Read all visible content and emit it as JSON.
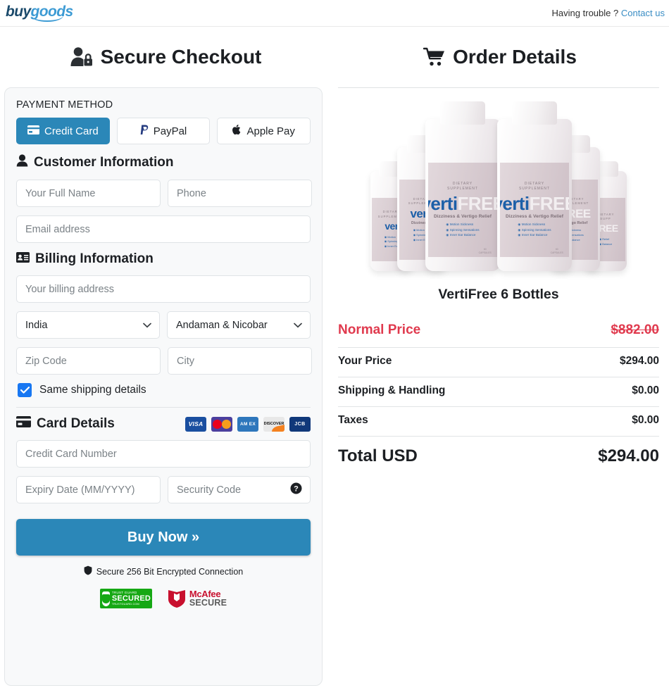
{
  "header": {
    "logo_buy": "buy",
    "logo_goods": "goods",
    "help_text": "Having trouble ?",
    "contact_link": "Contact us"
  },
  "left": {
    "title": "Secure Checkout",
    "payment_method_label": "PAYMENT METHOD",
    "payment_methods": [
      {
        "label": "Credit Card",
        "icon": "credit-card-icon",
        "active": true
      },
      {
        "label": "PayPal",
        "icon": "paypal-icon",
        "active": false
      },
      {
        "label": "Apple Pay",
        "icon": "apple-icon",
        "active": false
      }
    ],
    "customer_section": {
      "title": "Customer Information",
      "full_name_placeholder": "Your Full Name",
      "phone_placeholder": "Phone",
      "email_placeholder": "Email address"
    },
    "billing_section": {
      "title": "Billing Information",
      "address_placeholder": "Your billing address",
      "country_value": "India",
      "state_value": "Andaman & Nicobar",
      "zip_placeholder": "Zip Code",
      "city_placeholder": "City",
      "same_shipping_label": "Same shipping details",
      "same_shipping_checked": true
    },
    "card_section": {
      "title": "Card Details",
      "brands": [
        "VISA",
        "Mastercard",
        "AM EX",
        "DISCOVER",
        "JCB"
      ],
      "card_number_placeholder": "Credit Card Number",
      "expiry_placeholder": "Expiry Date (MM/YYYY)",
      "security_code_placeholder": "Security Code"
    },
    "buy_button": "Buy Now »",
    "secure_note": "Secure 256 Bit Encrypted Connection",
    "badges": {
      "trust_guard_top": "TRUST GUARD",
      "trust_guard_mid": "SECURED",
      "trust_guard_bottom": "TRUSTGUARD.COM",
      "mcafee_top": "McAfee",
      "mcafee_bottom": "SECURE"
    }
  },
  "right": {
    "title": "Order Details",
    "product_name": "VertiFree 6 Bottles",
    "product_label": {
      "supplement_line1": "DIETARY",
      "supplement_line2": "SUPPLEMENT",
      "brand_first": "verti",
      "brand_second": "FREE",
      "tagline": "Dizziness & Vertigo Relief",
      "bullets": [
        "Motion Sickness",
        "Spinning Sensations",
        "Inner Ear Balance"
      ],
      "count": "60",
      "count_unit": "CAPSULES"
    },
    "price_rows": [
      {
        "label": "Normal Price",
        "amount": "$882.00",
        "style": "normal"
      },
      {
        "label": "Your Price",
        "amount": "$294.00",
        "style": "regular"
      },
      {
        "label": "Shipping & Handling",
        "amount": "$0.00",
        "style": "regular"
      },
      {
        "label": "Taxes",
        "amount": "$0.00",
        "style": "regular"
      },
      {
        "label": "Total USD",
        "amount": "$294.00",
        "style": "total"
      }
    ]
  },
  "colors": {
    "accent_blue": "#2b87b8",
    "link_blue": "#3a8dc4",
    "checkbox_blue": "#1877f2",
    "strike_red": "#e03a4e"
  }
}
